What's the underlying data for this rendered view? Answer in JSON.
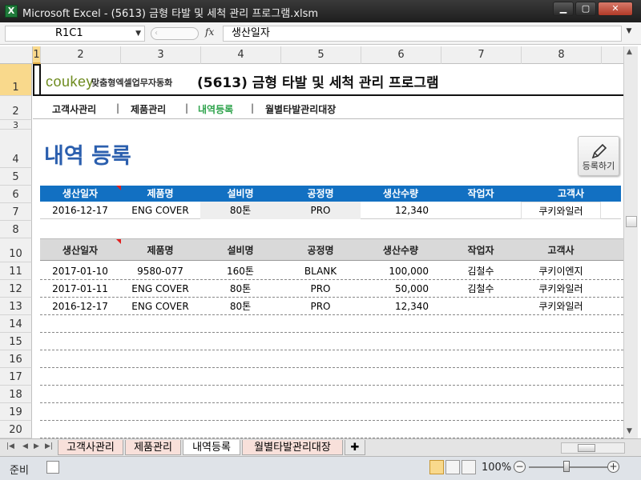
{
  "window": {
    "title": "Microsoft Excel - (5613) 금형 타발 및 세척 관리 프로그램.xlsm",
    "app_icon": "X"
  },
  "formula_bar": {
    "name_box": "R1C1",
    "formula": "생산일자",
    "fx": "fx"
  },
  "columns": [
    "1",
    "2",
    "3",
    "4",
    "5",
    "6",
    "7",
    "8"
  ],
  "rows": [
    "1",
    "2",
    "3",
    "4",
    "5",
    "6",
    "7",
    "8",
    "10",
    "11",
    "12",
    "13",
    "14",
    "15",
    "16",
    "17",
    "18",
    "19",
    "20"
  ],
  "header": {
    "logo": "coukey",
    "logo_sub": "맞춤형엑셀업무자동화",
    "app_title": "(5613) 금형 타발 및 세척 관리 프로그램"
  },
  "nav": {
    "items": [
      "고객사관리",
      "제품관리",
      "내역등록",
      "월별타발관리대장"
    ],
    "separator": "|"
  },
  "section": {
    "title": "내역 등록",
    "register_button": "등록하기"
  },
  "entry_table": {
    "headers": [
      "생산일자",
      "제품명",
      "설비명",
      "공정명",
      "생산수량",
      "작업자",
      "고객사"
    ],
    "row": [
      "2016-12-17",
      "ENG COVER",
      "80톤",
      "PRO",
      "12,340",
      "",
      "쿠키와일러"
    ]
  },
  "list_table": {
    "headers": [
      "생산일자",
      "제품명",
      "설비명",
      "공정명",
      "생산수량",
      "작업자",
      "고객사"
    ],
    "rows": [
      [
        "2017-01-10",
        "9580-077",
        "160톤",
        "BLANK",
        "100,000",
        "김철수",
        "쿠키이엔지"
      ],
      [
        "2017-01-11",
        "ENG COVER",
        "80톤",
        "PRO",
        "50,000",
        "김철수",
        "쿠키와일러"
      ],
      [
        "2016-12-17",
        "ENG COVER",
        "80톤",
        "PRO",
        "12,340",
        "",
        "쿠키와일러"
      ]
    ]
  },
  "sheet_tabs": [
    "고객사관리",
    "제품관리",
    "내역등록",
    "월별타발관리대장"
  ],
  "status": {
    "ready": "준비",
    "zoom": "100%"
  }
}
